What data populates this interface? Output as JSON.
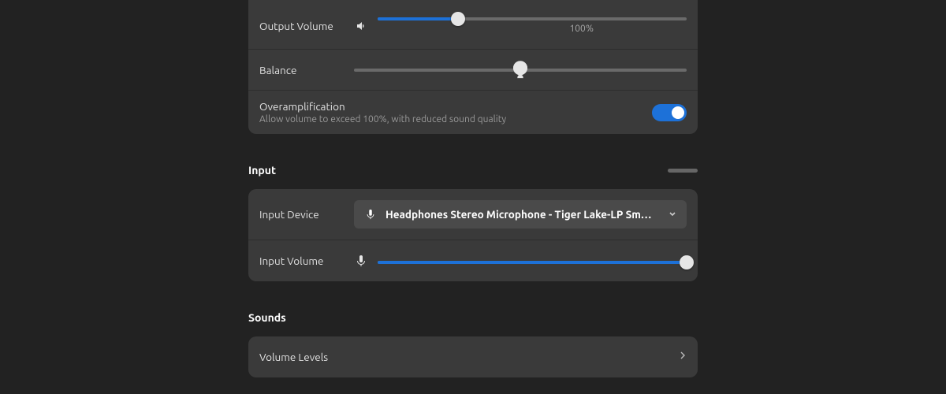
{
  "output": {
    "volume_label": "Output Volume",
    "volume_percent": 26,
    "balance_label": "Balance",
    "balance_percent": 50,
    "tick_100_label": "100%",
    "tick_100_position": 66,
    "overamp_title": "Overamplification",
    "overamp_sub": "Allow volume to exceed 100%, with reduced sound quality",
    "overamp_enabled": true
  },
  "input": {
    "section_title": "Input",
    "device_label": "Input Device",
    "device_value": "Headphones Stereo Microphone - Tiger Lake-LP Sm…",
    "volume_label": "Input Volume",
    "volume_percent": 100
  },
  "sounds": {
    "section_title": "Sounds",
    "volume_levels_label": "Volume Levels"
  }
}
